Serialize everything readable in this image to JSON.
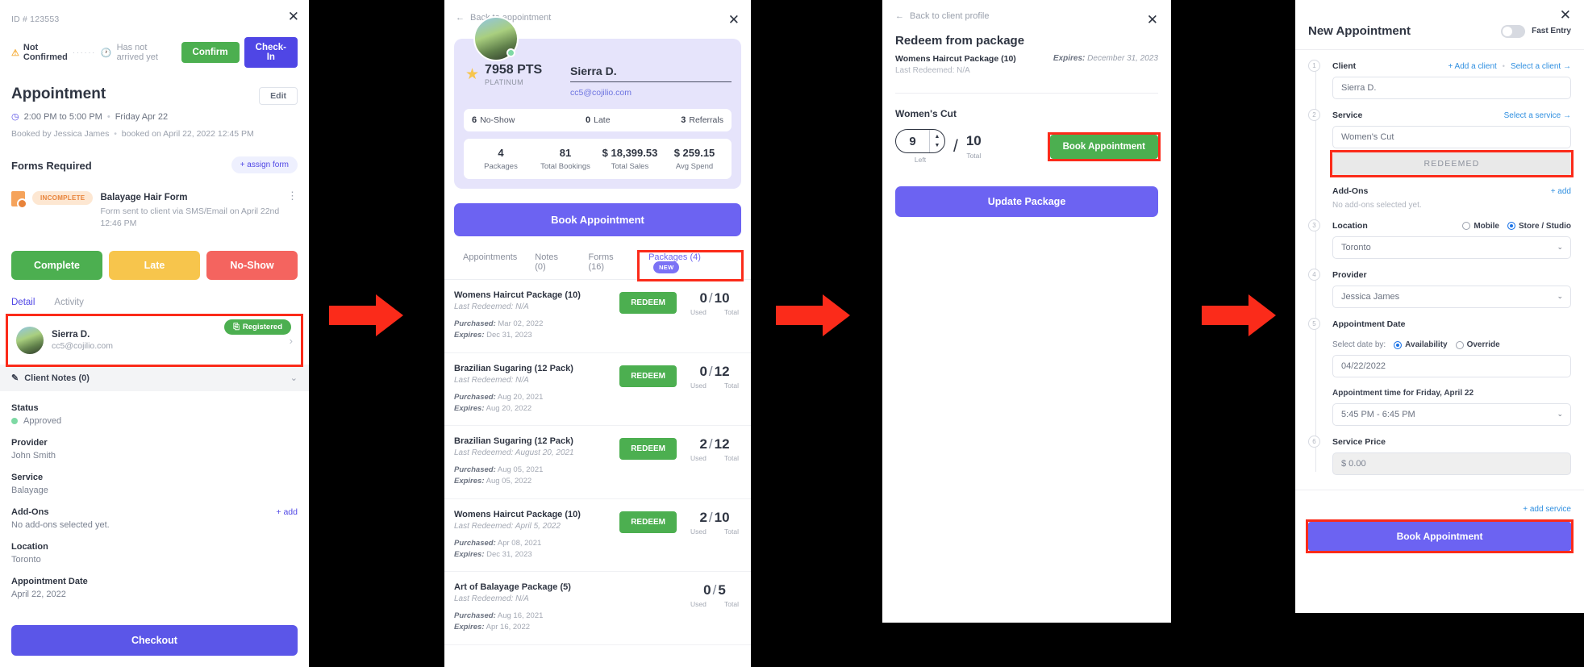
{
  "panel1": {
    "id_label": "ID # 123553",
    "status": "Not Confirmed",
    "arrival": "Has not arrived yet",
    "confirm_btn": "Confirm",
    "checkin_btn": "Check-In",
    "title": "Appointment",
    "edit_btn": "Edit",
    "time": "2:00 PM to 5:00 PM",
    "date": "Friday Apr 22",
    "booked_by": "Booked by Jessica James",
    "booked_on": "booked on April 22, 2022 12:45 PM",
    "forms_header": "Forms Required",
    "assign_form_btn": "+ assign form",
    "form": {
      "badge": "INCOMPLETE",
      "name": "Balayage Hair Form",
      "desc": "Form sent to client via SMS/Email on April 22nd 12:46 PM"
    },
    "actions": {
      "complete": "Complete",
      "late": "Late",
      "noshow": "No-Show"
    },
    "tabs": [
      "Detail",
      "Activity"
    ],
    "client": {
      "name": "Sierra D.",
      "email": "cc5@cojilio.com",
      "badge": "Registered"
    },
    "notes_header": "Client Notes (0)",
    "fields": [
      {
        "label": "Status",
        "value": "Approved"
      },
      {
        "label": "Provider",
        "value": "John Smith"
      },
      {
        "label": "Service",
        "value": "Balayage"
      },
      {
        "label": "Add-Ons",
        "value": "No add-ons selected yet.",
        "link": "+ add"
      },
      {
        "label": "Location",
        "value": "Toronto"
      },
      {
        "label": "Appointment Date",
        "value": "April 22, 2022"
      }
    ],
    "checkout_btn": "Checkout"
  },
  "panel2": {
    "back": "Back to appointment",
    "points": "7958 PTS",
    "tier": "PLATINUM",
    "name": "Sierra D.",
    "email": "cc5@cojilio.com",
    "quick_stats": [
      {
        "n": "6",
        "l": "No-Show"
      },
      {
        "n": "0",
        "l": "Late"
      },
      {
        "n": "3",
        "l": "Referrals"
      }
    ],
    "grid_stats": [
      {
        "n": "4",
        "l": "Packages"
      },
      {
        "n": "81",
        "l": "Total Bookings"
      },
      {
        "n": "$ 18,399.53",
        "l": "Total Sales"
      },
      {
        "n": "$ 259.15",
        "l": "Avg Spend"
      }
    ],
    "book_btn": "Book Appointment",
    "tabs": [
      {
        "label": "Appointments",
        "active": false
      },
      {
        "label": "Notes (0)",
        "active": false
      },
      {
        "label": "Forms (16)",
        "active": false
      },
      {
        "label": "Packages (4)",
        "active": true,
        "badge": "NEW"
      }
    ],
    "redeem_label": "REDEEM",
    "used_label": "Used",
    "total_label": "Total",
    "packages": [
      {
        "title": "Womens Haircut Package (10)",
        "last": "Last Redeemed: N/A",
        "purchased_label": "Purchased:",
        "purchased": "Mar 02, 2022",
        "expires_label": "Expires:",
        "expires": "Dec 31, 2023",
        "used": "0",
        "total": "10",
        "redeemable": true
      },
      {
        "title": "Brazilian Sugaring (12 Pack)",
        "last": "Last Redeemed: N/A",
        "purchased_label": "Purchased:",
        "purchased": "Aug 20, 2021",
        "expires_label": "Expires:",
        "expires": "Aug 20, 2022",
        "used": "0",
        "total": "12",
        "redeemable": true
      },
      {
        "title": "Brazilian Sugaring (12 Pack)",
        "last": "Last Redeemed: August 20, 2021",
        "purchased_label": "Purchased:",
        "purchased": "Aug 05, 2021",
        "expires_label": "Expires:",
        "expires": "Aug 05, 2022",
        "used": "2",
        "total": "12",
        "redeemable": true
      },
      {
        "title": "Womens Haircut Package (10)",
        "last": "Last Redeemed: April 5, 2022",
        "purchased_label": "Purchased:",
        "purchased": "Apr 08, 2021",
        "expires_label": "Expires:",
        "expires": "Dec 31, 2023",
        "used": "2",
        "total": "10",
        "redeemable": true
      },
      {
        "title": "Art of Balayage Package (5)",
        "last": "Last Redeemed: N/A",
        "purchased_label": "Purchased:",
        "purchased": "Aug 16, 2021",
        "expires_label": "Expires:",
        "expires": "Apr 16, 2022",
        "used": "0",
        "total": "5",
        "redeemable": false
      }
    ]
  },
  "panel3": {
    "back": "Back to client profile",
    "title": "Redeem from package",
    "package": "Womens Haircut Package (10)",
    "last_redeemed": "Last Redeemed: N/A",
    "expires_label": "Expires:",
    "expires": "December 31, 2023",
    "service": "Women's Cut",
    "left_value": "9",
    "left_label": "Left",
    "total_value": "10",
    "total_label": "Total",
    "book_btn": "Book Appointment",
    "update_btn": "Update Package"
  },
  "panel4": {
    "title": "New Appointment",
    "fast_entry": "Fast Entry",
    "client_label": "Client",
    "add_client": "+ Add a client",
    "select_client": "Select a client →",
    "client_value": "Sierra D.",
    "service_label": "Service",
    "select_service": "Select a service →",
    "service_value": "Women's Cut",
    "redeemed_bar": "REDEEMED",
    "addons_label": "Add-Ons",
    "addons_add": "+ add",
    "addons_note": "No add-ons selected yet.",
    "location_label": "Location",
    "mobile_label": "Mobile",
    "store_label": "Store / Studio",
    "location_value": "Toronto",
    "provider_label": "Provider",
    "provider_value": "Jessica James",
    "appt_date_label": "Appointment Date",
    "select_date_by": "Select date by:",
    "availability_label": "Availability",
    "override_label": "Override",
    "date_value": "04/22/2022",
    "time_label": "Appointment time for Friday, April 22",
    "time_value": "5:45 PM - 6:45 PM",
    "price_label": "Service Price",
    "price_value": "$ 0.00",
    "add_service": "+ add service",
    "book_btn": "Book Appointment",
    "step_numbers": [
      "1",
      "2",
      "3",
      "4",
      "5",
      "6"
    ]
  }
}
